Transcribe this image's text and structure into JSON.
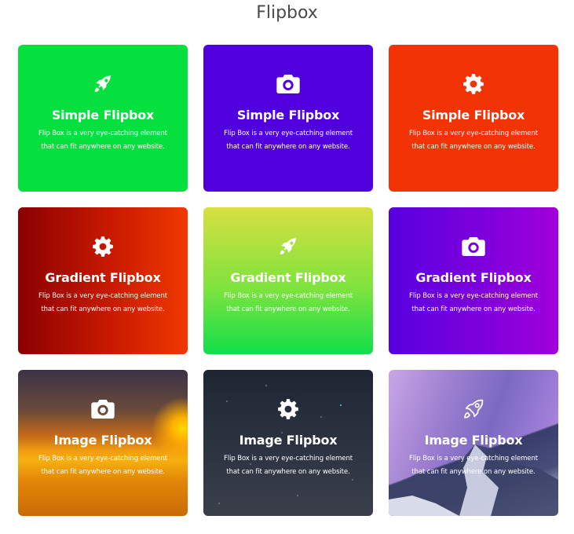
{
  "page": {
    "title": "Flipbox"
  },
  "cards": [
    {
      "title": "Simple Flipbox",
      "description": "Flip Box is a very eye-catching element that can fit anywhere on any website.",
      "icon": "rocket-icon",
      "style": "solid",
      "color": "#06e03f"
    },
    {
      "title": "Simple Flipbox",
      "description": "Flip Box is a very eye-catching element that can fit anywhere on any website.",
      "icon": "camera-icon",
      "style": "solid",
      "color": "#5000dc"
    },
    {
      "title": "Simple Flipbox",
      "description": "Flip Box is a very eye-catching element that can fit anywhere on any website.",
      "icon": "gear-icon",
      "style": "solid",
      "color": "#f23305"
    },
    {
      "title": "Gradient Flipbox",
      "description": "Flip Box is a very eye-catching element that can fit anywhere on any website.",
      "icon": "gear-icon",
      "style": "gradient",
      "color": "#8c0000"
    },
    {
      "title": "Gradient Flipbox",
      "description": "Flip Box is a very eye-catching element that can fit anywhere on any website.",
      "icon": "rocket-icon",
      "style": "gradient",
      "color": "#7fe33e"
    },
    {
      "title": "Gradient Flipbox",
      "description": "Flip Box is a very eye-catching element that can fit anywhere on any website.",
      "icon": "camera-icon",
      "style": "gradient",
      "color": "#7a00dc"
    },
    {
      "title": "Image Flipbox",
      "description": "Flip Box is a very eye-catching element that can fit anywhere on any website.",
      "icon": "camera-icon",
      "style": "image",
      "color": "#f09a10"
    },
    {
      "title": "Image Flipbox",
      "description": "Flip Box is a very eye-catching element that can fit anywhere on any website.",
      "icon": "gear-icon",
      "style": "image",
      "color": "#2b3240"
    },
    {
      "title": "Image Flipbox",
      "description": "Flip Box is a very eye-catching element that can fit anywhere on any website.",
      "icon": "rocket-outline-icon",
      "style": "image",
      "color": "#9d7fd0"
    }
  ]
}
